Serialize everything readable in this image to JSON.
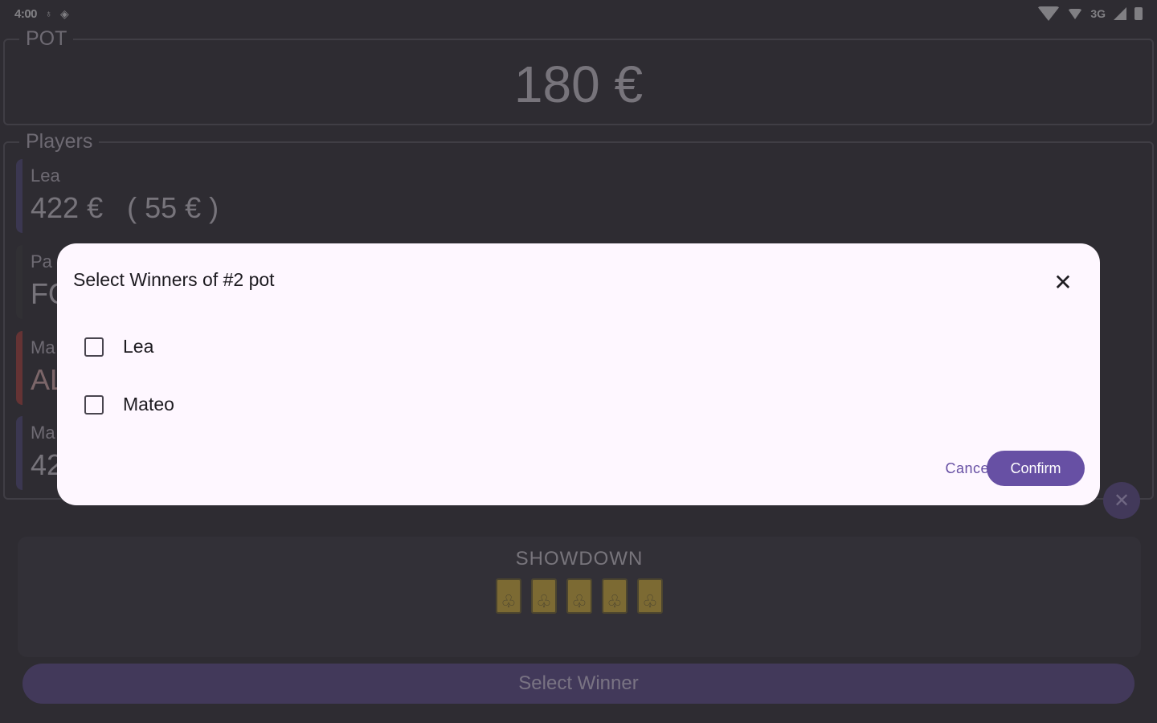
{
  "status_bar": {
    "time": "4:00",
    "network": "3G"
  },
  "pot": {
    "legend": "POT",
    "amount": "180 €"
  },
  "players": {
    "legend": "Players",
    "items": [
      {
        "name": "Lea",
        "amount": "422 €   ( 55 € )",
        "state": "active"
      },
      {
        "name": "Pa",
        "amount": "FO",
        "state": "fold"
      },
      {
        "name": "Ma",
        "amount": "AL",
        "state": "allin"
      },
      {
        "name": "Ma",
        "amount": "42",
        "state": "active"
      }
    ]
  },
  "showdown": {
    "title": "SHOWDOWN",
    "card_suit": "♧",
    "card_count": 5
  },
  "select_winner_label": "Select Winner",
  "dialog": {
    "title": "Select Winners of #2 pot",
    "options": [
      {
        "label": "Lea",
        "checked": false
      },
      {
        "label": "Mateo",
        "checked": false
      }
    ],
    "cancel_label": "Cancel",
    "confirm_label": "Confirm"
  },
  "colors": {
    "accent": "#6750a4",
    "allin": "#b3261e",
    "card": "#f3c21b"
  }
}
